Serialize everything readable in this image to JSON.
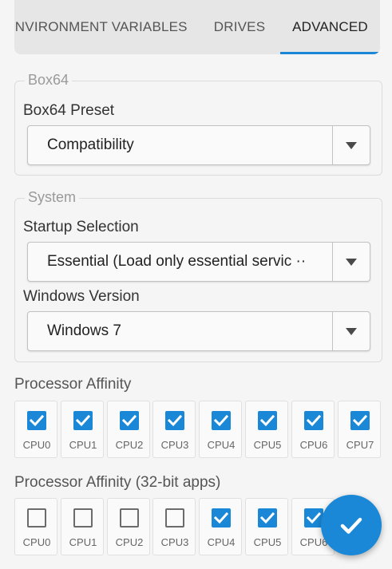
{
  "tabs": [
    {
      "label": "ENVIRONMENT VARIABLES"
    },
    {
      "label": "DRIVES"
    },
    {
      "label": "ADVANCED"
    }
  ],
  "active_tab": "ADVANCED",
  "box64": {
    "legend": "Box64",
    "preset_label": "Box64 Preset",
    "preset_value": "Compatibility"
  },
  "system": {
    "legend": "System",
    "startup_label": "Startup Selection",
    "startup_value": "Essential (Load only essential servic ··",
    "windows_label": "Windows Version",
    "windows_value": "Windows 7"
  },
  "affinity": {
    "title": "Processor Affinity",
    "cpus": [
      {
        "label": "CPU0",
        "checked": true
      },
      {
        "label": "CPU1",
        "checked": true
      },
      {
        "label": "CPU2",
        "checked": true
      },
      {
        "label": "CPU3",
        "checked": true
      },
      {
        "label": "CPU4",
        "checked": true
      },
      {
        "label": "CPU5",
        "checked": true
      },
      {
        "label": "CPU6",
        "checked": true
      },
      {
        "label": "CPU7",
        "checked": true
      }
    ]
  },
  "affinity32": {
    "title": "Processor Affinity (32-bit apps)",
    "cpus": [
      {
        "label": "CPU0",
        "checked": false
      },
      {
        "label": "CPU1",
        "checked": false
      },
      {
        "label": "CPU2",
        "checked": false
      },
      {
        "label": "CPU3",
        "checked": false
      },
      {
        "label": "CPU4",
        "checked": true
      },
      {
        "label": "CPU5",
        "checked": true
      },
      {
        "label": "CPU6",
        "checked": true
      }
    ]
  },
  "fab": {
    "icon": "check-icon"
  },
  "colors": {
    "accent": "#1a88d6"
  }
}
